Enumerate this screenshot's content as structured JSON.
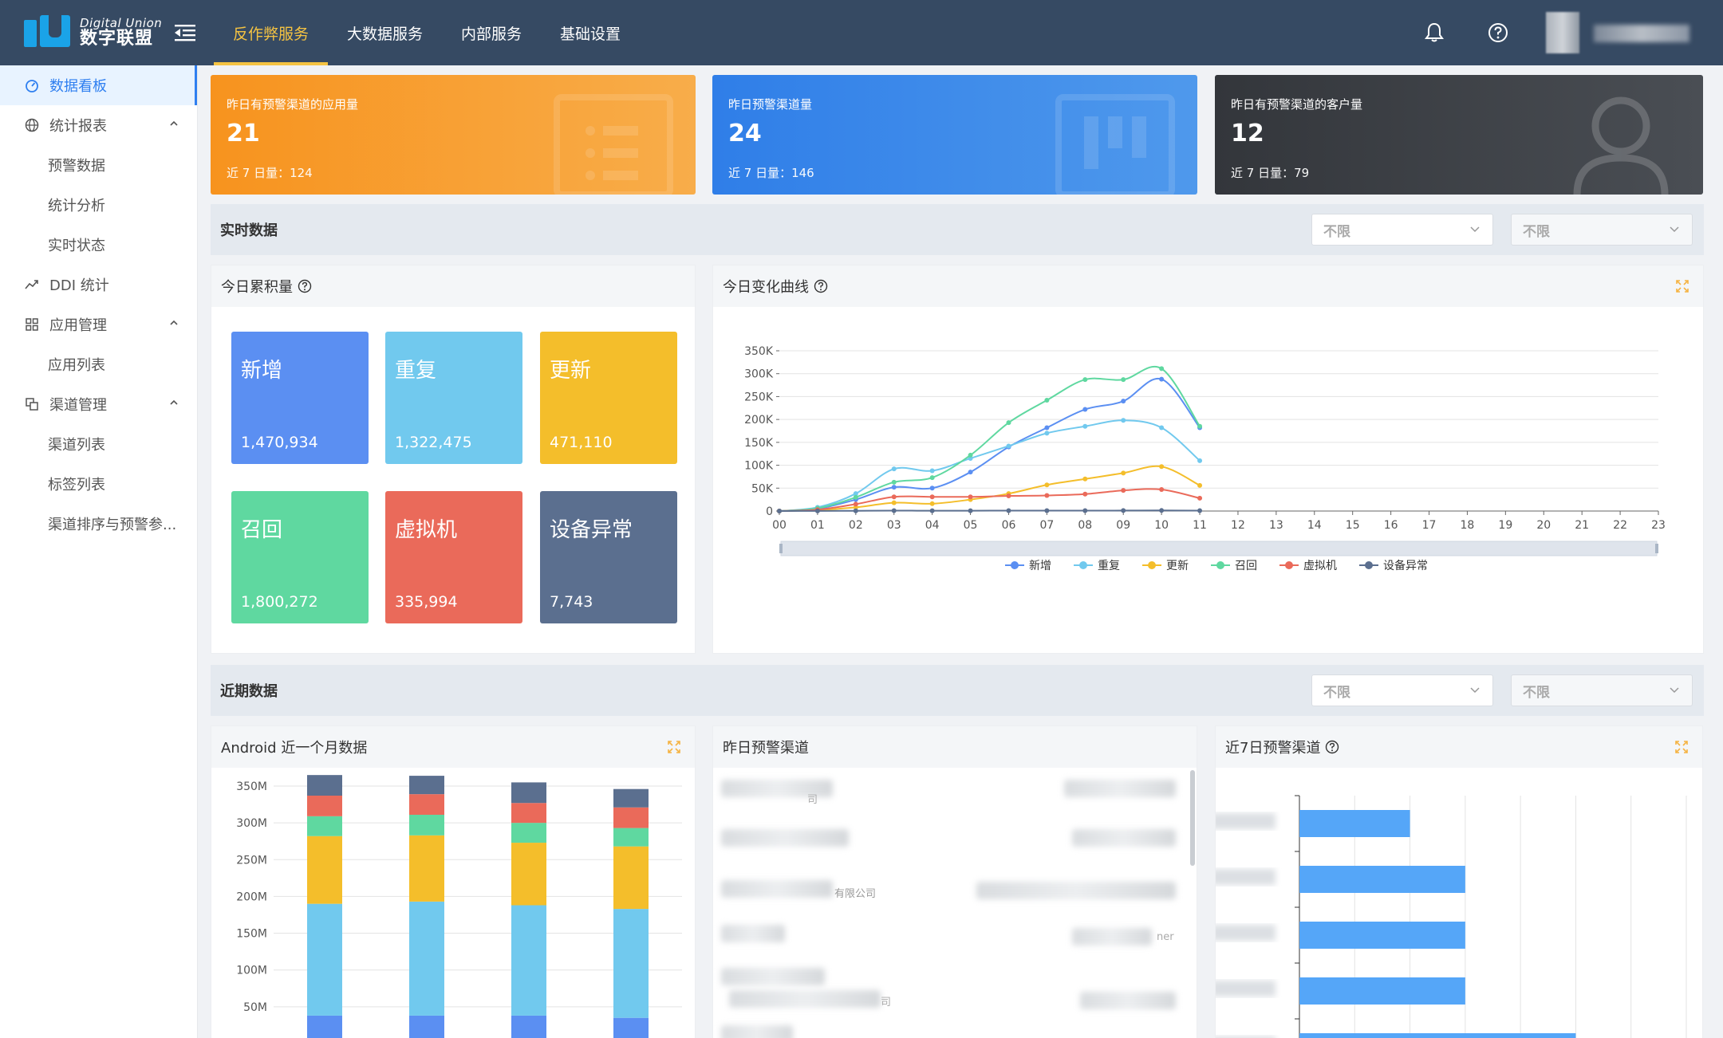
{
  "brand": {
    "name_en": "Digital Union",
    "name_cn": "数字联盟"
  },
  "topnav": [
    {
      "label": "反作弊服务",
      "active": true
    },
    {
      "label": "大数据服务",
      "active": false
    },
    {
      "label": "内部服务",
      "active": false
    },
    {
      "label": "基础设置",
      "active": false
    }
  ],
  "sidebar": {
    "dashboard": "数据看板",
    "reports": "统计报表",
    "reports_sub": [
      "预警数据",
      "统计分析",
      "实时状态"
    ],
    "ddi": "DDI 统计",
    "apps": "应用管理",
    "apps_sub": [
      "应用列表"
    ],
    "channels": "渠道管理",
    "channels_sub": [
      "渠道列表",
      "标签列表",
      "渠道排序与预警参..."
    ]
  },
  "stat_cards": [
    {
      "title": "昨日有预警渠道的应用量",
      "value": "21",
      "sub": "近 7 日量：124",
      "color": "#f7a33a"
    },
    {
      "title": "昨日预警渠道量",
      "value": "24",
      "sub": "近 7 日量：146",
      "color": "#3f8ae6"
    },
    {
      "title": "昨日有预警渠道的客户量",
      "value": "12",
      "sub": "近 7 日量：79",
      "color": "#3a3d42"
    }
  ],
  "realtime": {
    "label": "实时数据",
    "filter1": "不限",
    "filter2": "不限"
  },
  "today_total": {
    "title": "今日累积量",
    "tiles": [
      {
        "name": "新增",
        "value": "1,470,934",
        "color": "#5b8ff2"
      },
      {
        "name": "重复",
        "value": "1,322,475",
        "color": "#71c9ee"
      },
      {
        "name": "更新",
        "value": "471,110",
        "color": "#f4be2b"
      },
      {
        "name": "召回",
        "value": "1,800,272",
        "color": "#5fd8a0"
      },
      {
        "name": "虚拟机",
        "value": "335,994",
        "color": "#ea6a5a"
      },
      {
        "name": "设备异常",
        "value": "7,743",
        "color": "#5b6f8f"
      }
    ]
  },
  "today_curve": {
    "title": "今日变化曲线"
  },
  "recent": {
    "label": "近期数据",
    "filter1": "不限",
    "filter2": "不限"
  },
  "android_month": {
    "title": "Android 近一个月数据"
  },
  "yesterday_channels": {
    "title": "昨日预警渠道",
    "fragments": [
      "司",
      "有限公司",
      "ner",
      "司"
    ]
  },
  "week_channels": {
    "title": "近7日预警渠道"
  },
  "chart_data": [
    {
      "type": "line",
      "title": "今日变化曲线",
      "x": [
        "00",
        "01",
        "02",
        "03",
        "04",
        "05",
        "06",
        "07",
        "08",
        "09",
        "10",
        "11",
        "12",
        "13",
        "14",
        "15",
        "16",
        "17",
        "18",
        "19",
        "20",
        "21",
        "22",
        "23"
      ],
      "ylim": [
        0,
        350000
      ],
      "yticks": [
        "0",
        "50K",
        "100K",
        "150K",
        "200K",
        "250K",
        "300K",
        "350K"
      ],
      "grid": true,
      "legend": "bottom",
      "series": [
        {
          "name": "新增",
          "color": "#5b8ff2",
          "values": [
            0,
            5000,
            25000,
            52000,
            50000,
            85000,
            140000,
            182000,
            222000,
            240000,
            288000,
            182000
          ]
        },
        {
          "name": "重复",
          "color": "#71c9ee",
          "values": [
            0,
            8000,
            38000,
            92000,
            88000,
            115000,
            142000,
            170000,
            185000,
            198000,
            182000,
            110000
          ]
        },
        {
          "name": "更新",
          "color": "#f4be2b",
          "values": [
            0,
            2000,
            8000,
            18000,
            16000,
            25000,
            38000,
            57000,
            70000,
            83000,
            97000,
            56000
          ]
        },
        {
          "name": "召回",
          "color": "#5fd8a0",
          "values": [
            0,
            6000,
            30000,
            63000,
            73000,
            122000,
            193000,
            242000,
            287000,
            287000,
            311000,
            185000
          ]
        },
        {
          "name": "虚拟机",
          "color": "#ea6a5a",
          "values": [
            0,
            3000,
            15000,
            31000,
            31000,
            31000,
            33000,
            34000,
            37000,
            45000,
            47000,
            28000
          ]
        },
        {
          "name": "设备异常",
          "color": "#5b6f8f",
          "values": [
            0,
            200,
            500,
            800,
            700,
            700,
            900,
            900,
            900,
            1000,
            1200,
            800
          ]
        }
      ]
    },
    {
      "type": "bar",
      "title": "Android 近一个月数据",
      "ylim": [
        0,
        350
      ],
      "yticks": [
        "0",
        "50M",
        "100M",
        "150M",
        "200M",
        "250M",
        "300M",
        "350M"
      ],
      "stacked": true,
      "series": [
        {
          "name": "新增",
          "color": "#5b8ff2",
          "values": [
            38,
            38,
            38,
            35
          ]
        },
        {
          "name": "重复",
          "color": "#71c9ee",
          "values": [
            152,
            155,
            150,
            148
          ]
        },
        {
          "name": "更新",
          "color": "#f4be2b",
          "values": [
            92,
            90,
            85,
            85
          ]
        },
        {
          "name": "召回",
          "color": "#5fd8a0",
          "values": [
            27,
            28,
            27,
            25
          ]
        },
        {
          "name": "虚拟机",
          "color": "#ea6a5a",
          "values": [
            28,
            28,
            27,
            28
          ]
        },
        {
          "name": "设备异常",
          "color": "#5b6f8f",
          "values": [
            28,
            25,
            28,
            25
          ]
        }
      ]
    },
    {
      "type": "bar",
      "title": "近7日预警渠道",
      "orientation": "horizontal",
      "values": [
        2,
        3,
        3,
        3,
        5
      ],
      "xmax": 7,
      "color": "#55a6f8"
    }
  ]
}
